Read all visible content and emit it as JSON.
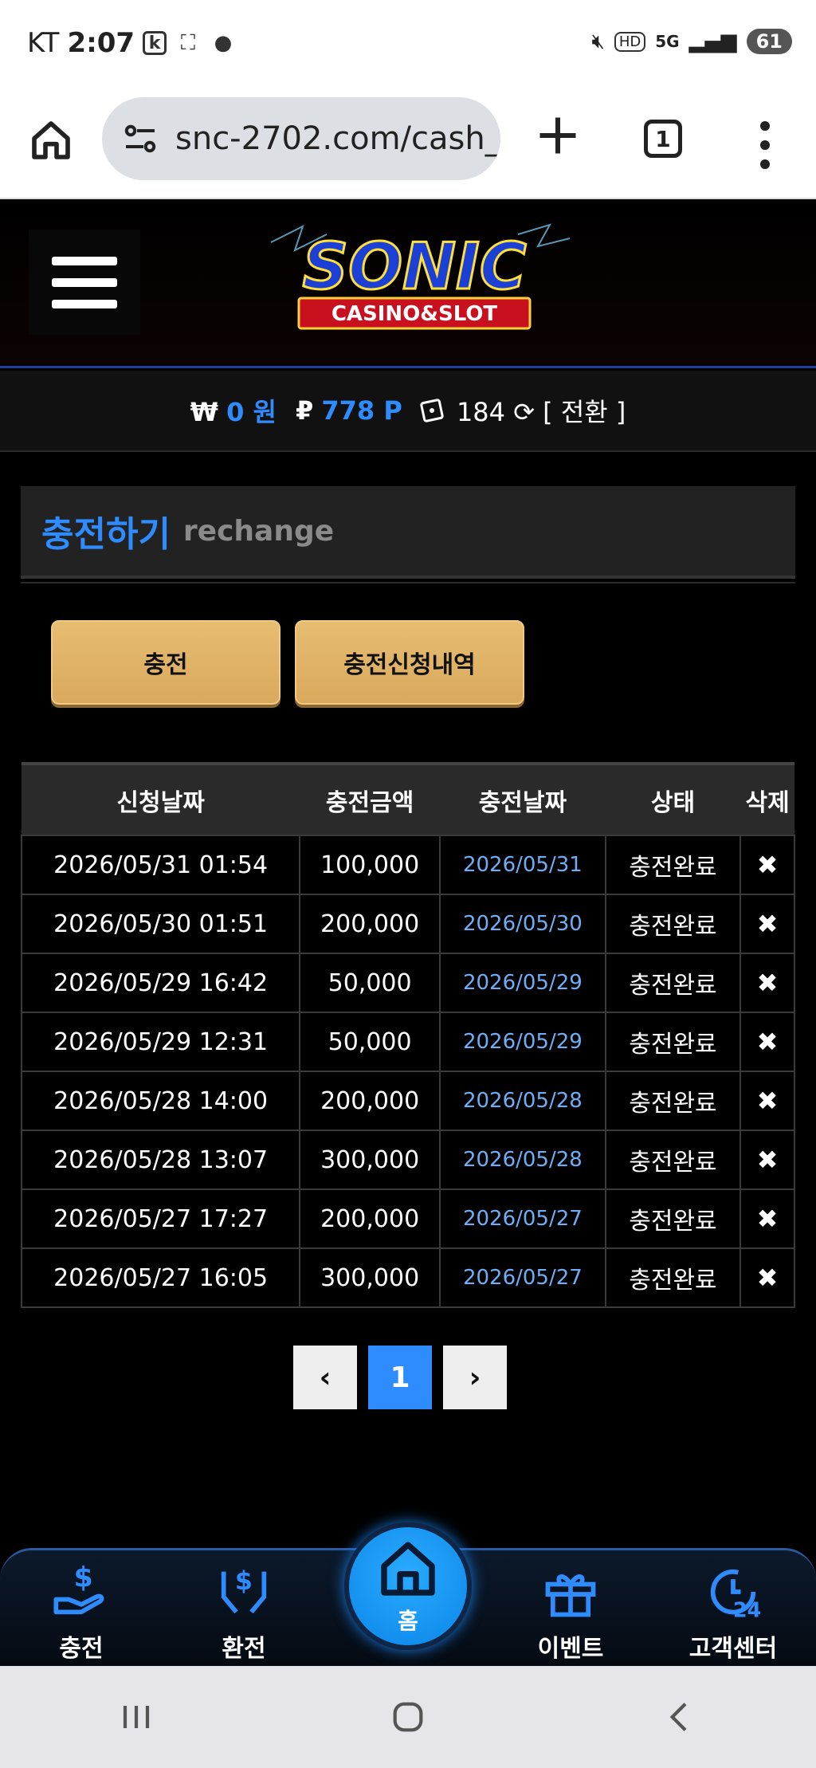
{
  "status_bar": {
    "carrier": "KT",
    "time": "2:07",
    "network": "5G",
    "battery": "61"
  },
  "browser": {
    "url": "snc-2702.com/cash_",
    "tab_count": "1"
  },
  "site": {
    "logo_text": "SONIC",
    "logo_sub": "CASINO&SLOT"
  },
  "balance": {
    "won_symbol": "₩",
    "won_value": "0 원",
    "point_symbol": "₽",
    "point_value": "778 P",
    "chips": "184",
    "switch_label": "[ 전환 ]"
  },
  "page_title": {
    "korean": "충전하기",
    "english": "rechange"
  },
  "buttons": {
    "charge": "충전",
    "history": "충전신청내역"
  },
  "table": {
    "headers": [
      "신청날짜",
      "충전금액",
      "충전날짜",
      "상태",
      "삭제"
    ],
    "rows": [
      {
        "request_date": "2026/05/31 01:54",
        "amount": "100,000",
        "charge_date": "2026/05/31",
        "status": "충전완료",
        "delete": "✖"
      },
      {
        "request_date": "2026/05/30 01:51",
        "amount": "200,000",
        "charge_date": "2026/05/30",
        "status": "충전완료",
        "delete": "✖"
      },
      {
        "request_date": "2026/05/29 16:42",
        "amount": "50,000",
        "charge_date": "2026/05/29",
        "status": "충전완료",
        "delete": "✖"
      },
      {
        "request_date": "2026/05/29 12:31",
        "amount": "50,000",
        "charge_date": "2026/05/29",
        "status": "충전완료",
        "delete": "✖"
      },
      {
        "request_date": "2026/05/28 14:00",
        "amount": "200,000",
        "charge_date": "2026/05/28",
        "status": "충전완료",
        "delete": "✖"
      },
      {
        "request_date": "2026/05/28 13:07",
        "amount": "300,000",
        "charge_date": "2026/05/28",
        "status": "충전완료",
        "delete": "✖"
      },
      {
        "request_date": "2026/05/27 17:27",
        "amount": "200,000",
        "charge_date": "2026/05/27",
        "status": "충전완료",
        "delete": "✖"
      },
      {
        "request_date": "2026/05/27 16:05",
        "amount": "300,000",
        "charge_date": "2026/05/27",
        "status": "충전완료",
        "delete": "✖"
      }
    ]
  },
  "pagination": {
    "prev": "‹",
    "current": "1",
    "next": "›"
  },
  "bottom_nav": {
    "charge": "충전",
    "exchange": "환전",
    "home": "홈",
    "event": "이벤트",
    "support": "고객센터"
  },
  "colors": {
    "accent_blue": "#2e8cff",
    "gold_button": "#e3b66b",
    "link_blue": "#6faef5"
  }
}
